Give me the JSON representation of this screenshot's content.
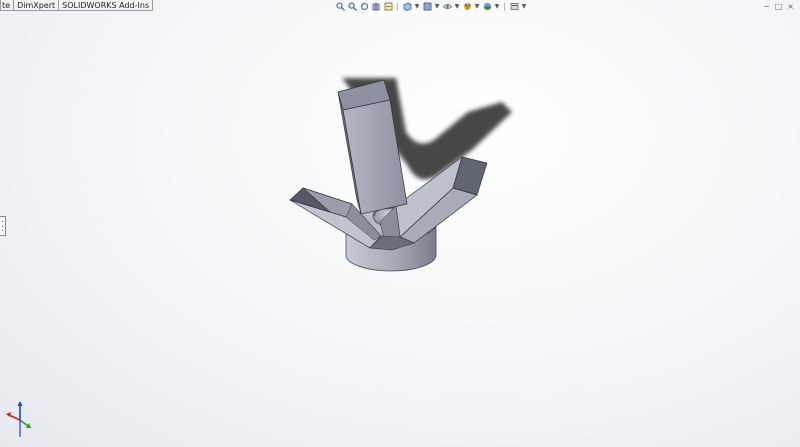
{
  "tabs": [
    {
      "label": "te"
    },
    {
      "label": "DimXpert"
    },
    {
      "label": "SOLIDWORKS Add-Ins"
    }
  ],
  "heads_up_toolbar": [
    "zoom-to-fit-icon",
    "zoom-to-area-icon",
    "previous-view-icon",
    "section-view-icon",
    "dynamic-annotation-icon",
    "view-orientation-icon",
    "display-style-icon",
    "hide-show-items-icon",
    "edit-appearance-icon",
    "apply-scene-icon",
    "view-settings-icon"
  ],
  "colors": {
    "accent": "#3a5f9a",
    "part_face_light": "#c5c8d4",
    "part_face_mid": "#9a9eac",
    "part_face_dark": "#555a66",
    "shadow": "#2e2e2e",
    "triad_x": "#d22020",
    "triad_y": "#20a020",
    "triad_z": "#2040d0"
  }
}
